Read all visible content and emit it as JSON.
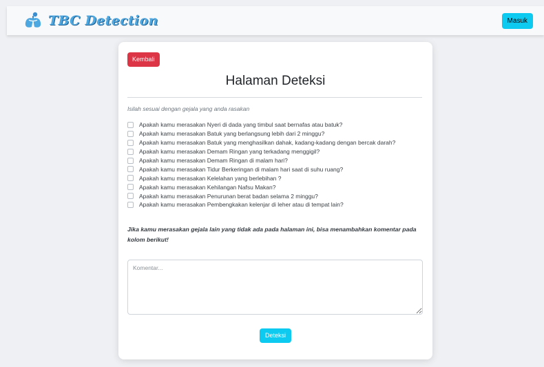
{
  "navbar": {
    "brand_icon": "lungs-logo-icon",
    "brand_text": "TBC Detection",
    "login_label": "Masuk"
  },
  "card": {
    "back_label": "Kembali",
    "title": "Halaman Deteksi",
    "subtitle": "Isilah sesuai dengan gejala yang anda rasakan",
    "questions": [
      "Apakah kamu merasakan Nyeri di dada yang timbul saat bernafas atau batuk?",
      "Apakah kamu merasakan Batuk yang berlangsung lebih dari 2 minggu?",
      "Apakah kamu merasakan Batuk yang menghasilkan dahak, kadang-kadang dengan bercak darah?",
      "Apakah kamu merasakan Demam Ringan yang terkadang menggigil?",
      "Apakah kamu merasakan Demam Ringan di malam hari?",
      "Apakah kamu merasakan Tidur Berkeringan di malam hari saat di suhu ruang?",
      "Apakah kamu merasakan Kelelahan yang berlebihan ?",
      "Apakah kamu merasakan Kehilangan Nafsu Makan?",
      "Apakah kamu merasakan Penurunan berat badan selama 2 minggu?",
      "Apakah kamu merasakan Pembengkakan kelenjar di leher atau di tempat lain?"
    ],
    "note": "Jika kamu merasakan gejala lain yang tidak ada pada halaman ini, bisa menambahkan komentar pada kolom berikut!",
    "comment_placeholder": "Komentar...",
    "comment_value": "",
    "detect_label": "Deteksi"
  },
  "colors": {
    "primary_info": "#0dcaf0",
    "danger": "#dc3545",
    "brand": "#4da7e0"
  }
}
